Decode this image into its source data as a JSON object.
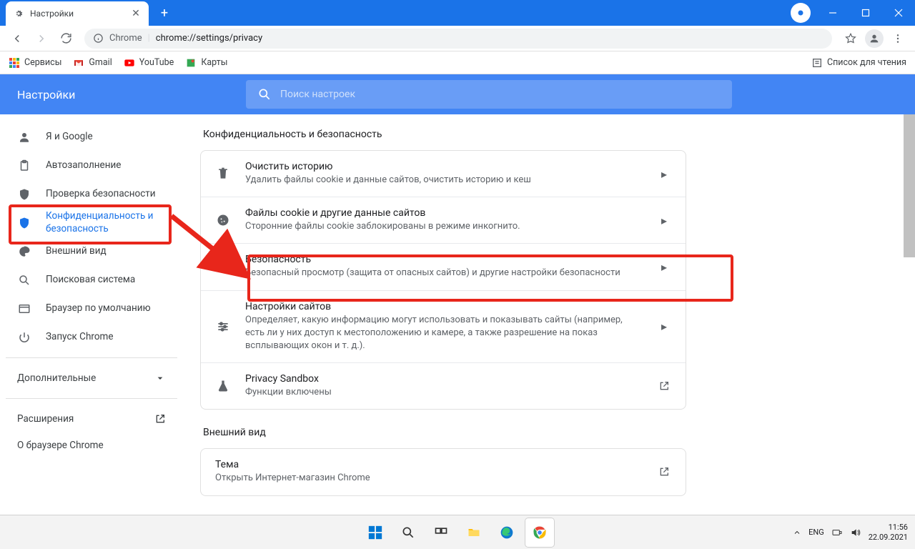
{
  "titlebar": {
    "tab_title": "Настройки"
  },
  "toolbar": {
    "chrome_label": "Chrome",
    "url": "chrome://settings/privacy"
  },
  "bookmarks": {
    "services": "Сервисы",
    "gmail": "Gmail",
    "youtube": "YouTube",
    "maps": "Карты",
    "reading_list": "Список для чтения"
  },
  "header": {
    "title": "Настройки",
    "search_placeholder": "Поиск настроек"
  },
  "sidebar": {
    "items": [
      {
        "label": "Я и Google"
      },
      {
        "label": "Автозаполнение"
      },
      {
        "label": "Проверка безопасности"
      },
      {
        "label": "Конфиденциальность и безопасность"
      },
      {
        "label": "Внешний вид"
      },
      {
        "label": "Поисковая система"
      },
      {
        "label": "Браузер по умолчанию"
      },
      {
        "label": "Запуск Chrome"
      }
    ],
    "advanced": "Дополнительные",
    "extensions": "Расширения",
    "about": "О браузере Chrome"
  },
  "sections": {
    "privacy": {
      "title": "Конфиденциальность и безопасность",
      "rows": [
        {
          "title": "Очистить историю",
          "sub": "Удалить файлы cookie и данные сайтов, очистить историю и кеш"
        },
        {
          "title": "Файлы cookie и другие данные сайтов",
          "sub": "Сторонние файлы cookie заблокированы в режиме инкогнито."
        },
        {
          "title": "Безопасность",
          "sub": "Безопасный просмотр (защита от опасных сайтов) и другие настройки безопасности"
        },
        {
          "title": "Настройки сайтов",
          "sub": "Определяет, какую информацию могут использовать и показывать сайты (например, есть ли у них доступ к местоположению и камере, а также разрешение на показ всплывающих окон и т. д.)."
        },
        {
          "title": "Privacy Sandbox",
          "sub": "Функции включены"
        }
      ]
    },
    "appearance": {
      "title": "Внешний вид",
      "rows": [
        {
          "title": "Тема",
          "sub": "Открыть Интернет-магазин Chrome"
        }
      ]
    }
  },
  "taskbar": {
    "lang": "ENG",
    "time": "11:56",
    "date": "22.09.2021"
  }
}
